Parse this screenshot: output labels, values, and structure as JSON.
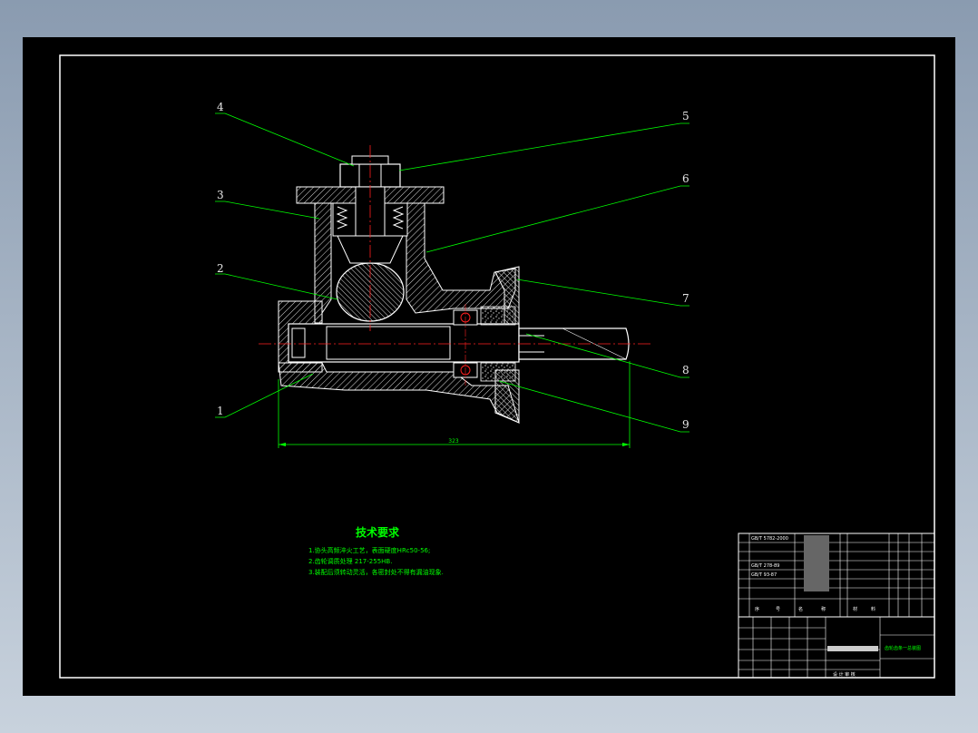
{
  "balloons": [
    {
      "id": "b1",
      "label": "1"
    },
    {
      "id": "b2",
      "label": "2"
    },
    {
      "id": "b3",
      "label": "3"
    },
    {
      "id": "b4",
      "label": "4"
    },
    {
      "id": "b5",
      "label": "5"
    },
    {
      "id": "b6",
      "label": "6"
    },
    {
      "id": "b7",
      "label": "7"
    },
    {
      "id": "b8",
      "label": "8"
    },
    {
      "id": "b9",
      "label": "9"
    }
  ],
  "dimension": {
    "overall_length": "323"
  },
  "tech_requirements": {
    "title": "技术要求",
    "lines": [
      "1.协头高频淬火工艺，表面硬度HRc50-56;",
      "2.齿轮调质处理  217-255HB.",
      "3.装配后须转动灵活，各密封处不得有漏油现象."
    ]
  },
  "title_block": {
    "part_rows": [
      "GB/T 5782-2000",
      "GB/T 278-89",
      "GB/T 93-87"
    ],
    "header_labels": [
      "序",
      "号",
      "名",
      "称",
      "材",
      "料"
    ],
    "drawing_name": "齿轮齿条一总装图",
    "designer_row": "设 计 审 核"
  },
  "colors": {
    "background": "#000000",
    "frame": "#ffffff",
    "leader": "#00ff00",
    "centerline": "#ff2020",
    "hatch": "#e8e8e8"
  }
}
